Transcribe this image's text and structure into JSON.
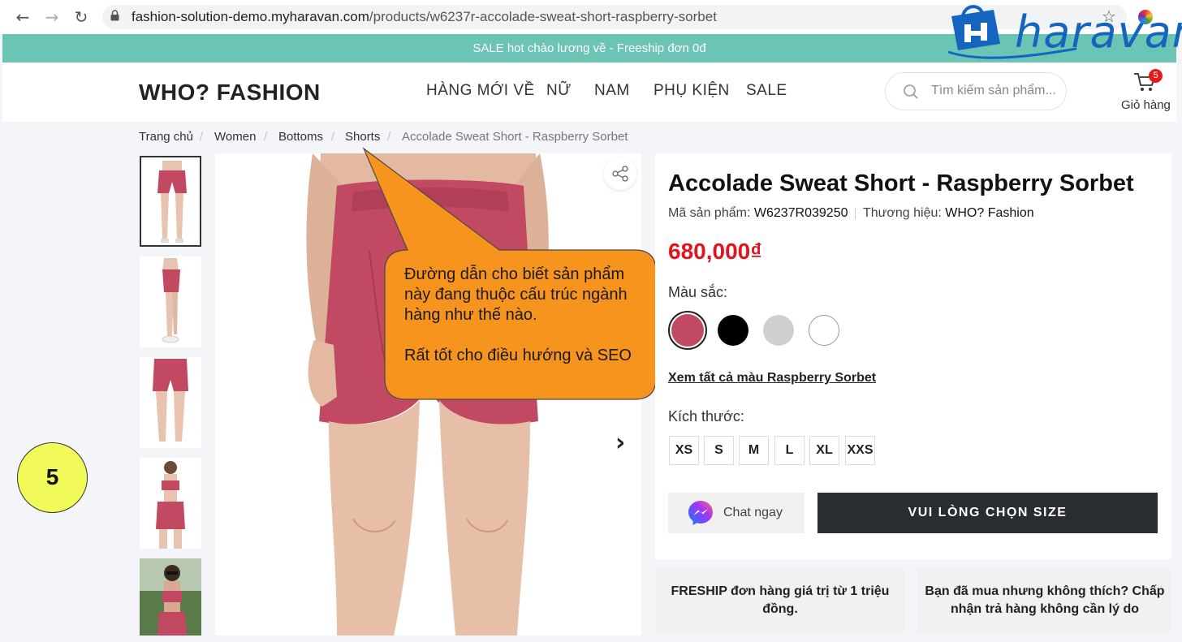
{
  "browser": {
    "url_host": "fashion-solution-demo.myharavan.com",
    "url_path": "/products/w6237r-accolade-sweat-short-raspberry-sorbet"
  },
  "watermark": {
    "logo_text": "haravan",
    "color": "#1565c0"
  },
  "announcement": {
    "text": "SALE hot chào lương về - Freeship đơn 0đ",
    "bg_color": "#6cc4b5"
  },
  "header": {
    "brand": "WHO? FASHION",
    "menu": [
      "HÀNG MỚI VỀ",
      "NỮ",
      "NAM",
      "PHỤ KIỆN",
      "SALE"
    ],
    "search_placeholder": "Tìm kiếm sản phẩm...",
    "cart_count": "5",
    "cart_label": "Giỏ hàng"
  },
  "breadcrumb": [
    "Trang chủ",
    "Women",
    "Bottoms",
    "Shorts",
    "Accolade Sweat Short - Raspberry Sorbet"
  ],
  "callout": {
    "line1": "Đường dẫn cho biết sản phẩm này đang thuộc cấu trúc ngành hàng như thế nào.",
    "line2": "Rất tốt cho điều hướng và SEO",
    "color": "#f7941d"
  },
  "step_number": "5",
  "product": {
    "title": "Accolade Sweat Short - Raspberry Sorbet",
    "sku_label": "Mã sản phẩm:",
    "sku": "W6237R039250",
    "brand_label": "Thương hiệu:",
    "brand": "WHO? Fashion",
    "price": "680,000₫",
    "color_label": "Màu sắc:",
    "colors": [
      "#c14a62",
      "#000000",
      "#cfcfcf",
      "#ffffff"
    ],
    "view_all_colors": "Xem tất cả màu Raspberry Sorbet",
    "size_label": "Kích thước:",
    "sizes": [
      "XS",
      "S",
      "M",
      "L",
      "XL",
      "XXS"
    ],
    "chat_label": "Chat ngay",
    "cta_label": "VUI LÒNG CHỌN SIZE"
  },
  "policies": [
    "FRESHIP đơn hàng giá trị từ 1 triệu đồng.",
    "Bạn đã mua nhưng không thích? Chấp nhận trả hàng không cần lý do"
  ]
}
